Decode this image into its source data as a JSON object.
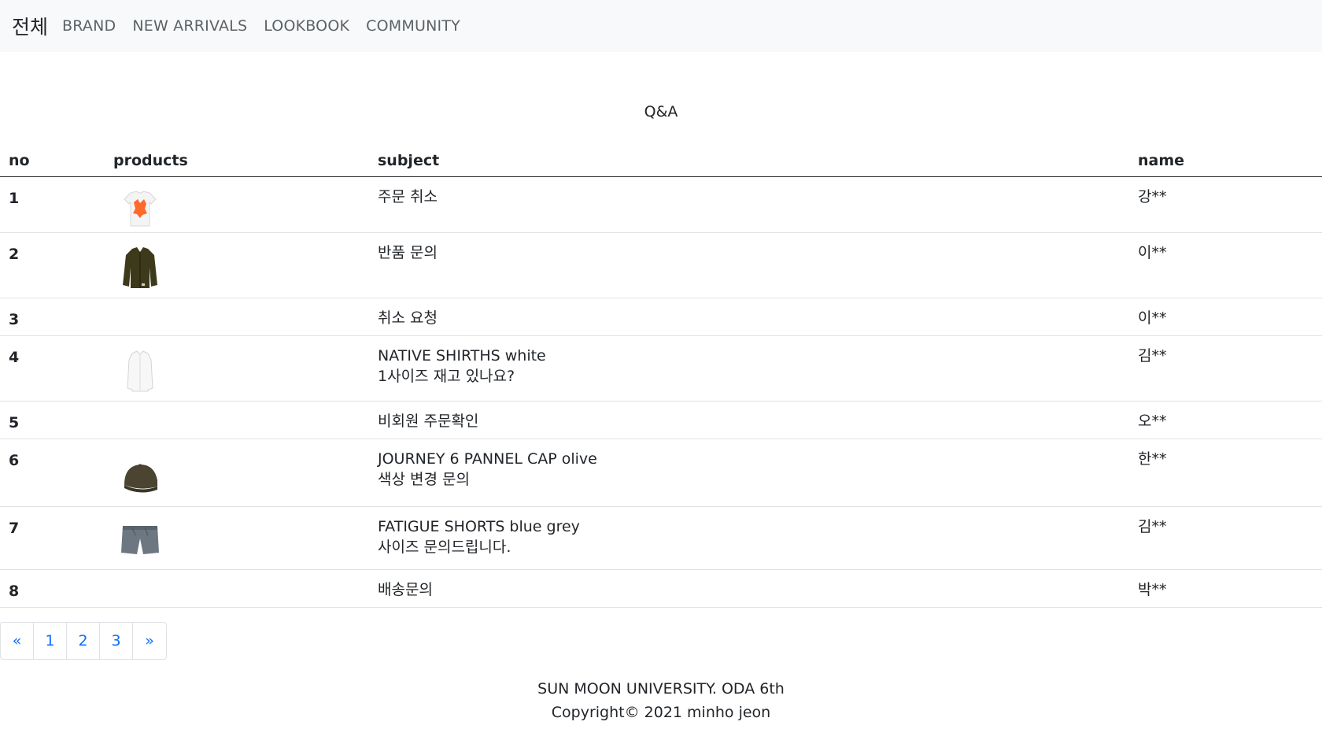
{
  "nav": {
    "brand": "전체",
    "links": [
      "BRAND",
      "NEW ARRIVALS",
      "LOOKBOOK",
      "COMMUNITY"
    ]
  },
  "page_title": "Q&A",
  "table": {
    "headers": [
      "no",
      "products",
      "subject",
      "name"
    ],
    "rows": [
      {
        "no": "1",
        "product": "t-shirt-icon",
        "subject_line1": "주문 취소",
        "subject_line2": "",
        "name": "강**"
      },
      {
        "no": "2",
        "product": "jacket-icon",
        "subject_line1": "반품 문의",
        "subject_line2": "",
        "name": "이**"
      },
      {
        "no": "3",
        "product": "",
        "subject_line1": "취소 요청",
        "subject_line2": "",
        "name": "이**"
      },
      {
        "no": "4",
        "product": "shirt-icon",
        "subject_line1": "NATIVE SHIRTHS white",
        "subject_line2": "1사이즈 재고 있나요?",
        "name": "김**"
      },
      {
        "no": "5",
        "product": "",
        "subject_line1": "비회원 주문확인",
        "subject_line2": "",
        "name": "오**"
      },
      {
        "no": "6",
        "product": "cap-icon",
        "subject_line1": "JOURNEY 6 PANNEL CAP olive",
        "subject_line2": "색상 변경 문의",
        "name": "한**"
      },
      {
        "no": "7",
        "product": "shorts-icon",
        "subject_line1": "FATIGUE SHORTS blue grey",
        "subject_line2": "사이즈 문의드립니다.",
        "name": "김**"
      },
      {
        "no": "8",
        "product": "",
        "subject_line1": "배송문의",
        "subject_line2": "",
        "name": "박**"
      }
    ]
  },
  "pagination": [
    "«",
    "1",
    "2",
    "3",
    "»"
  ],
  "footer": {
    "line1": "SUN MOON UNIVERSITY. ODA 6th",
    "line2": "Copyright© 2021 minho jeon"
  },
  "colors": {
    "link_blue": "#0d6efd",
    "navbar_bg": "#f8f9fa"
  }
}
